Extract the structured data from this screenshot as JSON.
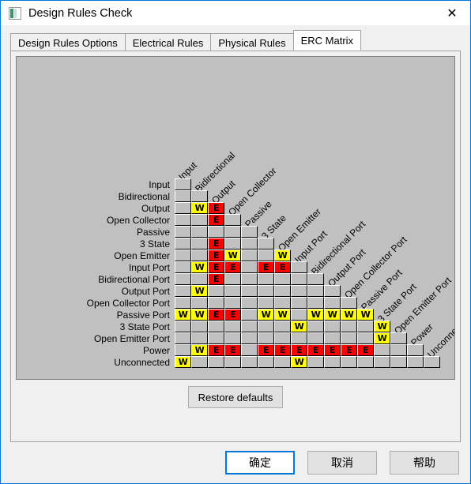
{
  "window": {
    "title": "Design Rules Check",
    "icon": "app-icon",
    "close_label": "✕"
  },
  "tabs": [
    {
      "label": "Design Rules Options",
      "active": false
    },
    {
      "label": "Electrical Rules",
      "active": false
    },
    {
      "label": "Physical Rules",
      "active": false
    },
    {
      "label": "ERC Matrix",
      "active": true
    }
  ],
  "matrix": {
    "labels": [
      "Input",
      "Bidirectional",
      "Output",
      "Open Collector",
      "Passive",
      "3 State",
      "Open Emitter",
      "Input Port",
      "Bidirectional Port",
      "Output Port",
      "Open Collector Port",
      "Passive Port",
      "3 State Port",
      "Open Emitter Port",
      "Power",
      "Unconnected"
    ],
    "legend": {
      "warning": "W",
      "error": "E",
      "none": ""
    },
    "colors": {
      "warning": "#ffff00",
      "error": "#ff0000",
      "none": "#c0c0c0",
      "panel": "#c0c0c0"
    },
    "rows": [
      [
        "none"
      ],
      [
        "none",
        "none"
      ],
      [
        "none",
        "warning",
        "error"
      ],
      [
        "none",
        "none",
        "error",
        "none"
      ],
      [
        "none",
        "none",
        "none",
        "none",
        "none"
      ],
      [
        "none",
        "none",
        "error",
        "none",
        "none",
        "none"
      ],
      [
        "none",
        "none",
        "error",
        "warning",
        "none",
        "none",
        "warning"
      ],
      [
        "none",
        "warning",
        "error",
        "error",
        "none",
        "error",
        "error",
        "none"
      ],
      [
        "none",
        "none",
        "error",
        "none",
        "none",
        "none",
        "none",
        "none",
        "none"
      ],
      [
        "none",
        "warning",
        "none",
        "none",
        "none",
        "none",
        "none",
        "none",
        "none",
        "none"
      ],
      [
        "none",
        "none",
        "none",
        "none",
        "none",
        "none",
        "none",
        "none",
        "none",
        "none",
        "none"
      ],
      [
        "warning",
        "warning",
        "error",
        "error",
        "none",
        "warning",
        "warning",
        "none",
        "warning",
        "warning",
        "warning",
        "warning"
      ],
      [
        "none",
        "none",
        "none",
        "none",
        "none",
        "none",
        "none",
        "warning",
        "none",
        "none",
        "none",
        "none",
        "warning"
      ],
      [
        "none",
        "none",
        "none",
        "none",
        "none",
        "none",
        "none",
        "none",
        "none",
        "none",
        "none",
        "none",
        "warning",
        "none"
      ],
      [
        "none",
        "warning",
        "error",
        "error",
        "none",
        "error",
        "error",
        "error",
        "error",
        "error",
        "error",
        "error",
        "none",
        "none",
        "none"
      ],
      [
        "warning",
        "none",
        "none",
        "none",
        "none",
        "none",
        "none",
        "warning",
        "none",
        "none",
        "none",
        "none",
        "none",
        "none",
        "none",
        "none"
      ]
    ]
  },
  "buttons": {
    "restore": "Restore defaults",
    "ok": "确定",
    "cancel": "取消",
    "help": "帮助"
  }
}
